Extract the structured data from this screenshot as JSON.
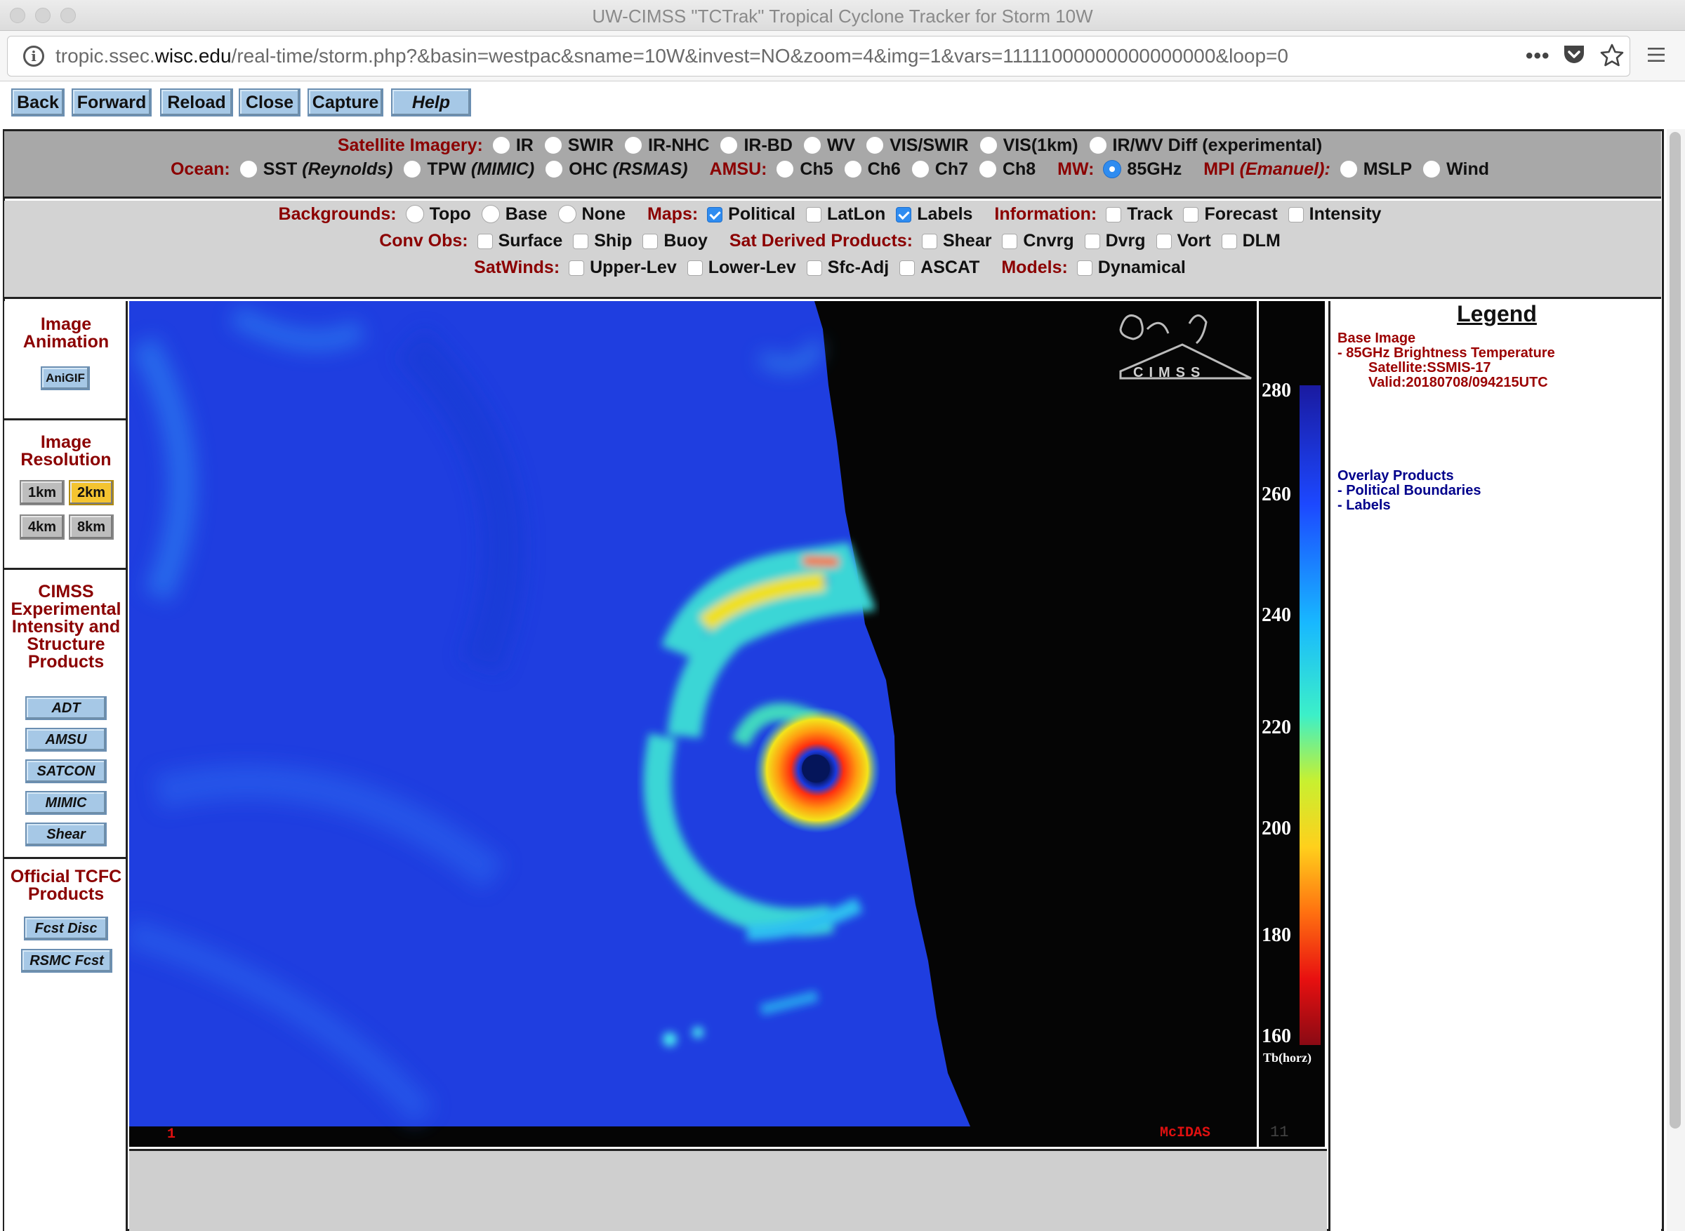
{
  "window": {
    "title": "UW-CIMSS \"TCTrak\" Tropical Cyclone Tracker for Storm 10W"
  },
  "browser": {
    "url_prefix": "tropic.ssec.",
    "url_host": "wisc.edu",
    "url_path": "/real-time/storm.php?&basin=westpac&sname=10W&invest=NO&zoom=4&img=1&vars=11111000000000000000&loop=0",
    "icons": [
      "info-icon",
      "more-icon",
      "pocket-icon",
      "bookmark-star-icon",
      "menu-icon"
    ]
  },
  "nav_buttons": [
    "Back",
    "Forward",
    "Reload",
    "Close",
    "Capture",
    "Help"
  ],
  "controls": {
    "satellite_label": "Satellite Imagery:",
    "satellite_options": [
      "IR",
      "SWIR",
      "IR-NHC",
      "IR-BD",
      "WV",
      "VIS/SWIR",
      "VIS(1km)",
      "IR/WV Diff (experimental)"
    ],
    "ocean_label": "Ocean:",
    "ocean_sst": "SST",
    "ocean_sst_src": "(Reynolds)",
    "ocean_tpw": "TPW",
    "ocean_tpw_src": "(MIMIC)",
    "ocean_ohc": "OHC",
    "ocean_ohc_src": "(RSMAS)",
    "amsu_label": "AMSU:",
    "amsu_options": [
      "Ch5",
      "Ch6",
      "Ch7",
      "Ch8"
    ],
    "mw_label": "MW:",
    "mw_option": "85GHz",
    "mpi_label": "MPI",
    "mpi_src": "(Emanuel):",
    "mpi_options": [
      "MSLP",
      "Wind"
    ],
    "backgrounds_label": "Backgrounds:",
    "backgrounds_options": [
      "Topo",
      "Base",
      "None"
    ],
    "maps_label": "Maps:",
    "maps_options": [
      "Political",
      "LatLon",
      "Labels"
    ],
    "information_label": "Information:",
    "information_options": [
      "Track",
      "Forecast",
      "Intensity"
    ],
    "convobs_label": "Conv Obs:",
    "convobs_options": [
      "Surface",
      "Ship",
      "Buoy"
    ],
    "satderived_label": "Sat Derived Products:",
    "satderived_options": [
      "Shear",
      "Cnvrg",
      "Dvrg",
      "Vort",
      "DLM"
    ],
    "satwinds_label": "SatWinds:",
    "satwinds_options": [
      "Upper-Lev",
      "Lower-Lev",
      "Sfc-Adj",
      "ASCAT"
    ],
    "models_label": "Models:",
    "models_options": [
      "Dynamical"
    ]
  },
  "sidebar": {
    "image_animation": {
      "title_1": "Image",
      "title_2": "Animation",
      "button": "AniGIF"
    },
    "image_resolution": {
      "title_1": "Image",
      "title_2": "Resolution",
      "buttons": [
        "1km",
        "2km",
        "4km",
        "8km"
      ],
      "selected": "2km"
    },
    "experimental": {
      "title_1": "CIMSS",
      "title_2": "Experimental",
      "title_3": "Intensity and",
      "title_4": "Structure",
      "title_5": "Products",
      "buttons": [
        "ADT",
        "AMSU",
        "SATCON",
        "MIMIC",
        "Shear"
      ]
    },
    "official": {
      "title_1": "Official TCFC",
      "title_2": "Products",
      "buttons": [
        "Fcst Disc",
        "RSMC Fcst"
      ]
    }
  },
  "image": {
    "frame_number": "1",
    "mcidas_label": "McIDAS",
    "frame_count_label": "11",
    "colorbar_ticks": [
      "280",
      "260",
      "240",
      "220",
      "200",
      "180",
      "160"
    ],
    "colorbar_unit": "Tb(horz)",
    "colors": {
      "ocean_blue": "#1f3ee0",
      "swath_black": "#050505",
      "eye_red": "#e8141e",
      "band_yellow": "#f4e21c",
      "band_cyan": "#2fd6e8"
    }
  },
  "legend": {
    "title": "Legend",
    "base_image_label": "Base Image",
    "base_item": "-  85GHz Brightness Temperature",
    "satellite": "Satellite:SSMIS-17",
    "valid": "Valid:20180708/094215UTC",
    "overlay_label": "Overlay Products",
    "overlay_items": [
      "-  Political Boundaries",
      "-  Labels"
    ]
  }
}
